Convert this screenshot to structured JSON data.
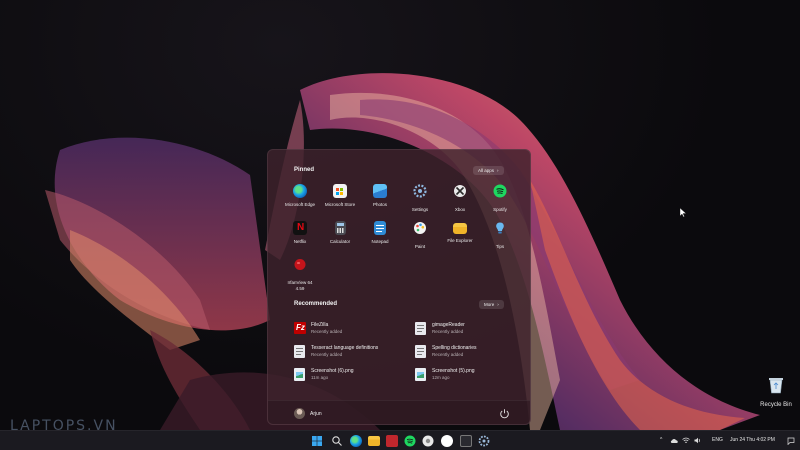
{
  "start_menu": {
    "pinned_title": "Pinned",
    "all_apps_label": "All apps",
    "pinned_apps": [
      {
        "label": "Microsoft Edge",
        "icon": "edge-icon"
      },
      {
        "label": "Microsoft Store",
        "icon": "store-icon"
      },
      {
        "label": "Photos",
        "icon": "photos-icon"
      },
      {
        "label": "Settings",
        "icon": "settings-icon"
      },
      {
        "label": "Xbox",
        "icon": "xbox-icon"
      },
      {
        "label": "Spotify",
        "icon": "spotify-icon"
      },
      {
        "label": "Netflix",
        "icon": "netflix-icon"
      },
      {
        "label": "Calculator",
        "icon": "calculator-icon"
      },
      {
        "label": "Notepad",
        "icon": "notepad-icon"
      },
      {
        "label": "Paint",
        "icon": "paint-icon"
      },
      {
        "label": "File Explorer",
        "icon": "folder-icon"
      },
      {
        "label": "Tips",
        "icon": "tips-icon"
      },
      {
        "label": "IrfanView 64",
        "label2": "4.59",
        "icon": "irfanview-icon"
      }
    ],
    "recommended_title": "Recommended",
    "more_label": "More",
    "recommended": [
      {
        "name": "FileZilla",
        "sub": "Recently added",
        "icon": "filezilla-icon"
      },
      {
        "name": "gimageReader",
        "sub": "Recently added",
        "icon": "document-icon"
      },
      {
        "name": "Tesseract language definitions",
        "sub": "Recently added",
        "icon": "document-icon"
      },
      {
        "name": "Spelling dictionaries",
        "sub": "Recently added",
        "icon": "document-icon"
      },
      {
        "name": "Screenshot (6).png",
        "sub": "11m ago",
        "icon": "image-file-icon"
      },
      {
        "name": "Screenshot (5).png",
        "sub": "12m ago",
        "icon": "image-file-icon"
      }
    ],
    "user_name": "Arjun"
  },
  "desktop": {
    "recycle_bin_label": "Recycle Bin"
  },
  "watermark": "LAPTOPS.VN",
  "taskbar": {
    "icons": [
      "windows-start-icon",
      "search-icon",
      "edge-icon",
      "folder-icon",
      "store-icon",
      "spotify-icon",
      "chrome-icon",
      "chat-icon",
      "terminal-icon",
      "settings-icon"
    ],
    "tray": {
      "language": "ENG",
      "datetime": "Jun 24 Thu  4:02 PM"
    }
  },
  "colors": {
    "menu_bg": "#3e222c",
    "taskbar_bg": "#1b1a20",
    "accent": "#e3573a"
  }
}
